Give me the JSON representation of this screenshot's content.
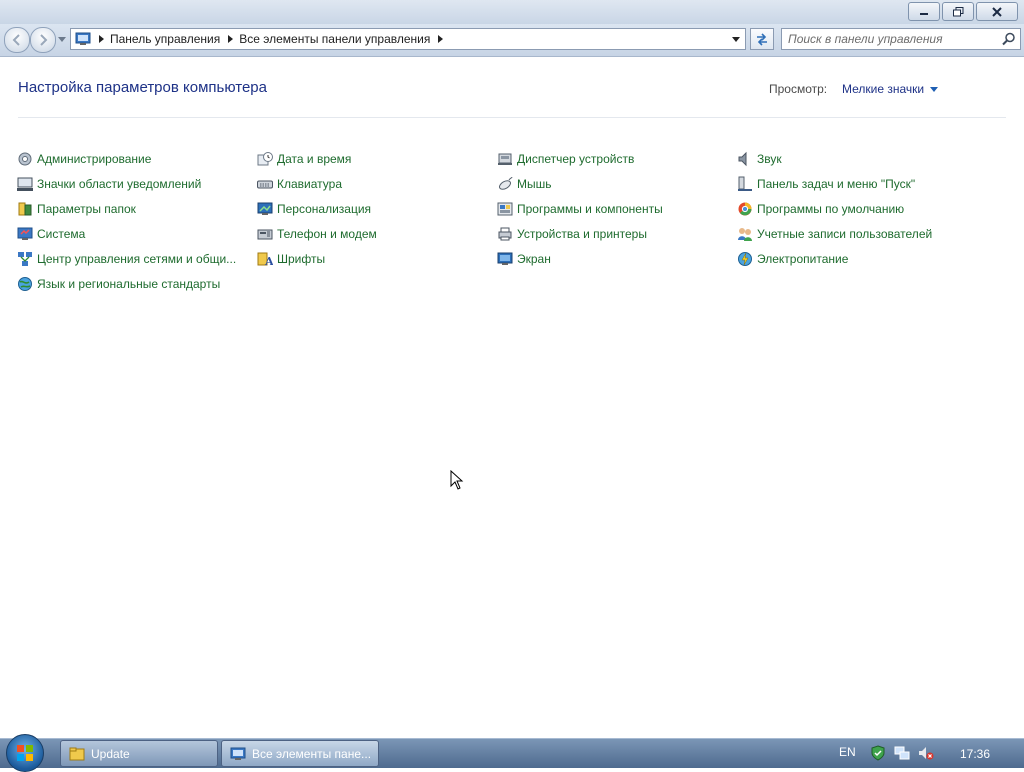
{
  "window": {
    "controls": {
      "minimize_icon": "minimize-icon",
      "maximize_icon": "restore-icon",
      "close_icon": "close-icon"
    }
  },
  "address_bar": {
    "breadcrumbs": [
      "Панель управления",
      "Все элементы панели управления"
    ],
    "search_placeholder": "Поиск в панели управления"
  },
  "header": {
    "title": "Настройка параметров компьютера",
    "view_label": "Просмотр:",
    "view_value": "Мелкие значки"
  },
  "items": {
    "col1": [
      {
        "label": "Администрирование",
        "icon": "admin-tools-icon"
      },
      {
        "label": "Значки области уведомлений",
        "icon": "notification-icons-icon"
      },
      {
        "label": "Параметры папок",
        "icon": "folder-options-icon"
      },
      {
        "label": "Система",
        "icon": "system-icon"
      },
      {
        "label": "Центр управления сетями и общи...",
        "icon": "network-center-icon"
      },
      {
        "label": "Язык и региональные стандарты",
        "icon": "region-language-icon"
      }
    ],
    "col2": [
      {
        "label": "Дата и время",
        "icon": "date-time-icon"
      },
      {
        "label": "Клавиатура",
        "icon": "keyboard-icon"
      },
      {
        "label": "Персонализация",
        "icon": "personalization-icon"
      },
      {
        "label": "Телефон и модем",
        "icon": "phone-modem-icon"
      },
      {
        "label": "Шрифты",
        "icon": "fonts-icon"
      }
    ],
    "col3": [
      {
        "label": "Диспетчер устройств",
        "icon": "device-manager-icon"
      },
      {
        "label": "Мышь",
        "icon": "mouse-icon"
      },
      {
        "label": "Программы и компоненты",
        "icon": "programs-features-icon"
      },
      {
        "label": "Устройства и принтеры",
        "icon": "devices-printers-icon"
      },
      {
        "label": "Экран",
        "icon": "display-icon"
      }
    ],
    "col4": [
      {
        "label": "Звук",
        "icon": "sound-icon"
      },
      {
        "label": "Панель задач и меню \"Пуск\"",
        "icon": "taskbar-start-icon"
      },
      {
        "label": "Программы по умолчанию",
        "icon": "default-programs-icon"
      },
      {
        "label": "Учетные записи пользователей",
        "icon": "user-accounts-icon"
      },
      {
        "label": "Электропитание",
        "icon": "power-options-icon"
      }
    ]
  },
  "taskbar": {
    "tasks": [
      {
        "label": "Update",
        "icon": "folder-icon"
      },
      {
        "label": "Все элементы пане...",
        "icon": "control-panel-icon"
      }
    ],
    "language": "EN",
    "clock": "17:36"
  },
  "colors": {
    "link_green": "#1e6b2e",
    "title_blue": "#1e3287",
    "taskbar": "#5d7aa0"
  }
}
